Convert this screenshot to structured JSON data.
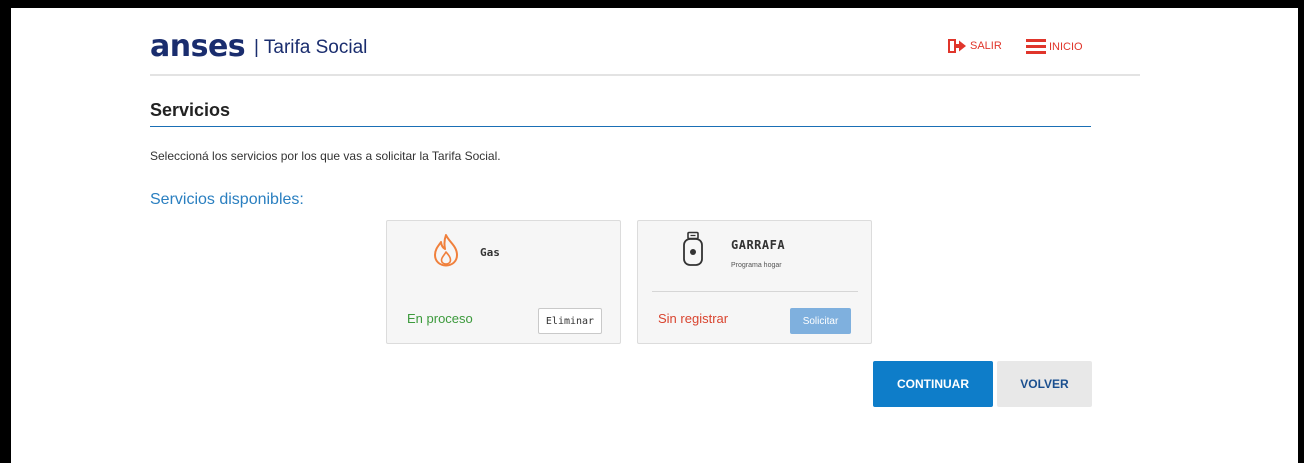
{
  "header": {
    "logo_text": "anses",
    "app_title": "| Tarifa Social",
    "salir_label": "SALIR",
    "inicio_label": "INICIO",
    "logout_icon": "logout-icon",
    "menu_icon": "hamburger-menu-icon"
  },
  "page": {
    "title": "Servicios",
    "intro": "Seleccioná los servicios por los que vas a solicitar la Tarifa Social.",
    "subheading": "Servicios disponibles:"
  },
  "services": [
    {
      "name": "Gas",
      "icon": "flame-icon",
      "status": "En proceso",
      "action_label": "Eliminar"
    },
    {
      "name": "GARRAFA",
      "subtitle": "Programa hogar",
      "icon": "gas-cylinder-icon",
      "status": "Sin registrar",
      "action_label": "Solicitar"
    }
  ],
  "actions": {
    "continue_label": "CONTINUAR",
    "back_label": "VOLVER"
  },
  "colors": {
    "brand_blue": "#1a2d6e",
    "accent_blue": "#0e7dc9",
    "link_red": "#e0352b",
    "status_green": "#3c9a3c",
    "status_red": "#d9442f"
  }
}
